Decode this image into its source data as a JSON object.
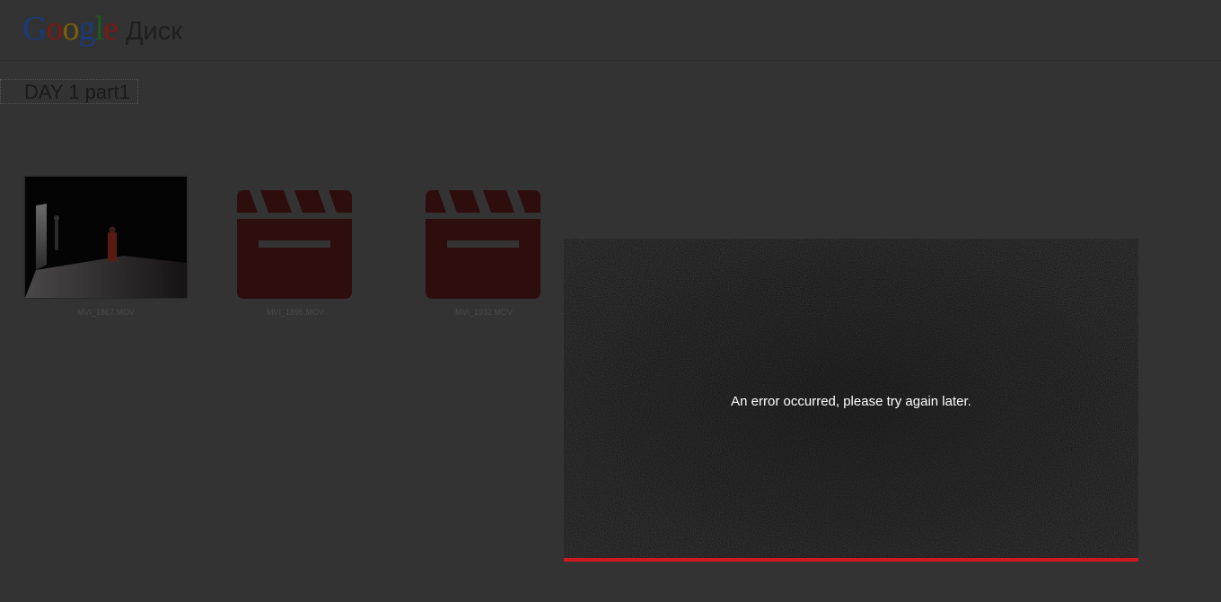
{
  "header": {
    "logo_letters": [
      {
        "char": "G",
        "color": "#1a3a7a"
      },
      {
        "char": "o",
        "color": "#7a1a14"
      },
      {
        "char": "o",
        "color": "#7a6008"
      },
      {
        "char": "g",
        "color": "#1a3a7a"
      },
      {
        "char": "l",
        "color": "#1f5a22"
      },
      {
        "char": "e",
        "color": "#7a1a14"
      }
    ],
    "product_name": "Диск"
  },
  "folder": {
    "title": "DAY 1 part1"
  },
  "files": [
    {
      "name": "MVI_1867.MOV",
      "thumbnail": "photo"
    },
    {
      "name": "MVI_1895.MOV",
      "thumbnail": "clapperboard-icon"
    },
    {
      "name": "MVI_1932.MOV",
      "thumbnail": "clapperboard-icon"
    }
  ],
  "player": {
    "error_message": "An error occurred, please try again later.",
    "accent_color": "#cc181e"
  },
  "colors": {
    "overlay_background": "#333333",
    "clapper_icon": "#2e0e0c"
  }
}
